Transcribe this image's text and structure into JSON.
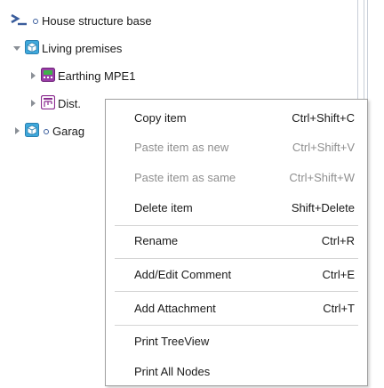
{
  "tree": {
    "root": {
      "label": "House structure base"
    },
    "living": {
      "label": "Living premises"
    },
    "earthing": {
      "label": "Earthing MPE1"
    },
    "dist": {
      "label": "Dist."
    },
    "garage": {
      "label": "Garag"
    }
  },
  "menu": {
    "items": [
      {
        "label": "Copy item",
        "shortcut": "Ctrl+Shift+C",
        "enabled": true
      },
      {
        "label": "Paste item as new",
        "shortcut": "Ctrl+Shift+V",
        "enabled": false
      },
      {
        "label": "Paste item as same",
        "shortcut": "Ctrl+Shift+W",
        "enabled": false
      },
      {
        "label": "Delete item",
        "shortcut": "Shift+Delete",
        "enabled": true
      },
      {
        "label": "Rename",
        "shortcut": "Ctrl+R",
        "enabled": true
      },
      {
        "label": "Add/Edit Comment",
        "shortcut": "Ctrl+E",
        "enabled": true
      },
      {
        "label": "Add Attachment",
        "shortcut": "Ctrl+T",
        "enabled": true
      },
      {
        "label": "Print TreeView",
        "shortcut": "",
        "enabled": true
      },
      {
        "label": "Print All Nodes",
        "shortcut": "",
        "enabled": true
      }
    ]
  },
  "colors": {
    "icon_blue": "#3a5d9c",
    "living_icon": "#3fa9dc",
    "earthing_icon": "#9b3ea8",
    "earthing_screen": "#3fb24a",
    "dist_icon": "#8a2b8f",
    "selection": "#dfe6f3"
  }
}
